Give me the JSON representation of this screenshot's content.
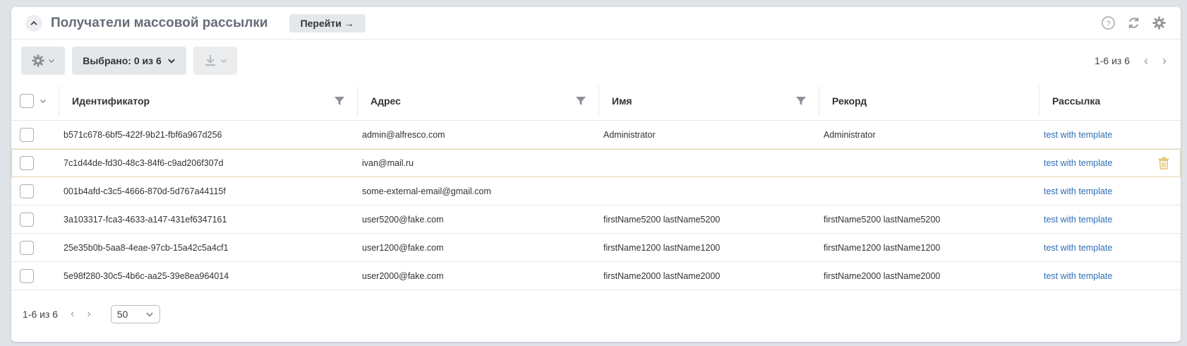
{
  "header": {
    "title": "Получатели массовой рассылки",
    "goto_label": "Перейти →"
  },
  "toolbar": {
    "selected_label": "Выбрано: 0 из 6",
    "pager_text": "1-6 из 6"
  },
  "table": {
    "columns": [
      "Идентификатор",
      "Адрес",
      "Имя",
      "Рекорд",
      "Рассылка"
    ],
    "rows": [
      {
        "id": "b571c678-6bf5-422f-9b21-fbf6a967d256",
        "address": "admin@alfresco.com",
        "name": "Administrator",
        "record": "Administrator",
        "mailing": "test with template"
      },
      {
        "id": "7c1d44de-fd30-48c3-84f6-c9ad206f307d",
        "address": "ivan@mail.ru",
        "name": "",
        "record": "",
        "mailing": "test with template"
      },
      {
        "id": "001b4afd-c3c5-4666-870d-5d767a44115f",
        "address": "some-external-email@gmail.com",
        "name": "",
        "record": "",
        "mailing": "test with template"
      },
      {
        "id": "3a103317-fca3-4633-a147-431ef6347161",
        "address": "user5200@fake.com",
        "name": "firstName5200 lastName5200",
        "record": "firstName5200 lastName5200",
        "mailing": "test with template"
      },
      {
        "id": "25e35b0b-5aa8-4eae-97cb-15a42c5a4cf1",
        "address": "user1200@fake.com",
        "name": "firstName1200 lastName1200",
        "record": "firstName1200 lastName1200",
        "mailing": "test with template"
      },
      {
        "id": "5e98f280-30c5-4b6c-aa25-39e8ea964014",
        "address": "user2000@fake.com",
        "name": "firstName2000 lastName2000",
        "record": "firstName2000 lastName2000",
        "mailing": "test with template"
      }
    ]
  },
  "footer": {
    "pager_text": "1-6 из 6",
    "page_size": "50"
  },
  "colors": {
    "link": "#2f6fb3",
    "hover_border": "#e7d6a6",
    "trash": "#e0c36f"
  }
}
